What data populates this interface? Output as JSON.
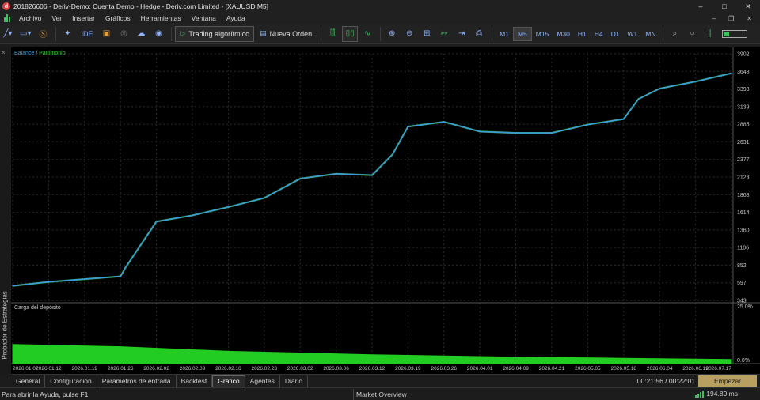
{
  "window": {
    "title": "201826606 - Deriv-Demo: Cuenta Demo - Hedge - Deriv.com Limited - [XAUUSD,M5]",
    "app_icon_glyph": "d"
  },
  "menu": [
    "Archivo",
    "Ver",
    "Insertar",
    "Gráficos",
    "Herramientas",
    "Ventana",
    "Ayuda"
  ],
  "toolbar": {
    "ide_label": "IDE",
    "algo_trading_label": "Trading algorítmico",
    "new_order_label": "Nueva Orden",
    "timeframes": [
      "M1",
      "M5",
      "M15",
      "M30",
      "H1",
      "H4",
      "D1",
      "W1",
      "MN"
    ],
    "active_timeframe": "M5"
  },
  "side_panel": {
    "label": "Probador de Estrategias",
    "close_glyph": "×"
  },
  "chart": {
    "legend_balance": "Balance",
    "legend_sep": " / ",
    "legend_equity": "Patrimonio",
    "deposit_label": "Carga del depósito",
    "colors": {
      "balance": "#3a9ad9",
      "equity": "#3fbf3f",
      "load": "#22cc22",
      "grid": "#2a2a2a",
      "axis_text": "#c8c8c8"
    }
  },
  "chart_data": {
    "type": "line",
    "series": [
      {
        "name": "Balance",
        "x": [
          "2026.01.02",
          "2026.01.12",
          "2026.01.19",
          "2026.01.26",
          "2026.01.27",
          "2026.02.02",
          "2026.02.09",
          "2026.02.16",
          "2026.02.23",
          "2026.03.02",
          "2026.03.06",
          "2026.03.12",
          "2026.03.16",
          "2026.03.19",
          "2026.03.26",
          "2026.04.01",
          "2026.04.09",
          "2026.04.21",
          "2026.05.05",
          "2026.05.18",
          "2026.05.25",
          "2026.06.04",
          "2026.06.19",
          "2026.07.17"
        ],
        "values": [
          553,
          610,
          650,
          690,
          820,
          1480,
          1570,
          1690,
          1820,
          2100,
          2170,
          2150,
          2450,
          2850,
          2920,
          2780,
          2760,
          2760,
          2880,
          2960,
          3250,
          3400,
          3500,
          3620
        ]
      }
    ],
    "y_ticks": [
      3902,
      3648,
      3393,
      3139,
      2885,
      2631,
      2377,
      2123,
      1868,
      1614,
      1360,
      1106,
      852,
      597,
      343
    ],
    "ylim": [
      343,
      3902
    ],
    "x_ticks": [
      "2026.01.02",
      "2026.01.12",
      "2026.01.19",
      "2026.01.26",
      "2026.02.02",
      "2026.02.09",
      "2026.02.16",
      "2026.02.23",
      "2026.03.02",
      "2026.03.06",
      "2026.03.12",
      "2026.03.19",
      "2026.03.26",
      "2026.04.01",
      "2026.04.09",
      "2026.04.21",
      "2026.05.05",
      "2026.05.18",
      "2026.06.04",
      "2026.06.19",
      "2026.07.17"
    ],
    "deposit_load": {
      "y_ticks": [
        "25.0%",
        "0.0%"
      ],
      "ylim": [
        0,
        25
      ],
      "x": [
        "2026.01.02",
        "2026.01.26",
        "2026.02.16",
        "2026.03.12",
        "2026.04.09",
        "2026.05.18",
        "2026.07.17"
      ],
      "values": [
        8.5,
        7.5,
        5.5,
        4.0,
        3.0,
        2.5,
        2.0
      ]
    },
    "grid": true
  },
  "bottom_tabs": [
    "General",
    "Configuración",
    "Parámetros de entrada",
    "Backtest",
    "Gráfico",
    "Agentes",
    "Diario"
  ],
  "active_tab": "Gráfico",
  "timer": "00:21:56 / 00:22:01",
  "start_button": "Empezar",
  "status": {
    "help": "Para abrir la Ayuda, pulse F1",
    "market": "Market Overview",
    "ping": "194.89 ms"
  }
}
